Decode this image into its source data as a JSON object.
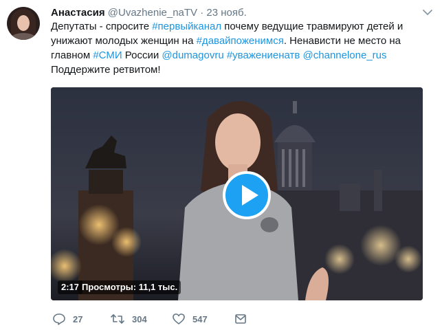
{
  "tweet": {
    "author_name": "Анастасия",
    "author_handle": "@Uvazhenie_naTV",
    "separator": "·",
    "date": "23 нояб.",
    "text": {
      "t1": "Депутаты - спросите ",
      "l1": "#первыйканал",
      "t2": " почему ведущие травмируют детей и унижают молодых женщин на ",
      "l2": "#давайпоженимся",
      "t3": ". Ненависти не место на главном ",
      "l3": "#СМИ",
      "t4": " России ",
      "l4": "@dumagovru",
      "t5": " ",
      "l5": "#уважениенатв",
      "t6": " ",
      "l6": "@channelone_rus",
      "t7": "Поддержите ретвитом!"
    },
    "video": {
      "duration": "2:17",
      "views": "Просмотры: 11,1 тыс."
    },
    "actions": {
      "reply_count": "27",
      "retweet_count": "304",
      "like_count": "547"
    }
  },
  "colors": {
    "link": "#1b95e0",
    "muted": "#657786",
    "play_button": "#1da1f2"
  },
  "icons": [
    "caret-down-icon",
    "reply-icon",
    "retweet-icon",
    "like-icon",
    "direct-message-icon",
    "play-icon"
  ]
}
